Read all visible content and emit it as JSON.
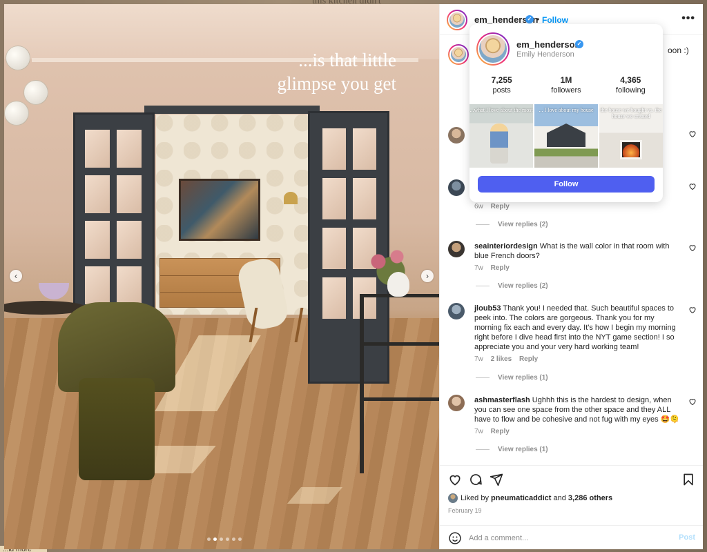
{
  "backdrop": {
    "top_text": "this kitchen didn't",
    "bottom_tag": "...ld more"
  },
  "photo": {
    "overlay_text_line1": "...is that little",
    "overlay_text_line2": "glimpse you get",
    "slide_count": 6,
    "active_slide": 2
  },
  "post": {
    "username": "em_henderson",
    "verified": true,
    "separator": "•",
    "follow_label": "Follow",
    "more_label": "•••",
    "caption_tail": "oon :)"
  },
  "hover_card": {
    "username": "em_henderson",
    "full_name": "Emily Henderson",
    "stats": [
      {
        "value": "7,255",
        "label": "posts"
      },
      {
        "value": "1M",
        "label": "followers"
      },
      {
        "value": "4,365",
        "label": "following"
      }
    ],
    "thumbs": [
      {
        "caption": "...what I love about the most"
      },
      {
        "caption": "... I love about my house"
      },
      {
        "caption": "the house we bought vs. the house we created"
      }
    ],
    "follow_label": "Follow"
  },
  "comments": [
    {
      "username": "",
      "text": "",
      "time": "",
      "likes": "",
      "reply": ""
    },
    {
      "username": "",
      "text": "",
      "time": "6w",
      "likes": "",
      "reply": "Reply",
      "view_replies": "View replies (2)"
    },
    {
      "username": "seainteriordesign",
      "text": "What is the wall color in that room with blue French doors?",
      "time": "7w",
      "likes": "",
      "reply": "Reply",
      "view_replies": "View replies (2)"
    },
    {
      "username": "jloub53",
      "text": "Thank you! I needed that. Such beautiful spaces to peek into. The colors are gorgeous. Thank you for my morning fix each and every day. It's how I begin my morning right before I dive head first into the NYT game section! I so appreciate you and your very hard working team!",
      "time": "7w",
      "likes": "2 likes",
      "reply": "Reply",
      "view_replies": "View replies (1)"
    },
    {
      "username": "ashmasterflash",
      "text": "Ughhh this is the hardest to design, when you can see one space from the other space and they ALL have to flow and be cohesive and not fug with my eyes 🤩🫠",
      "time": "7w",
      "likes": "",
      "reply": "Reply",
      "view_replies": "View replies (1)"
    }
  ],
  "actions": {
    "liked_by_prefix": "Liked by ",
    "liked_by_user": "pneumaticaddict",
    "liked_by_and": " and ",
    "liked_by_count": "3,286 others",
    "date": "February 19",
    "comment_placeholder": "Add a comment...",
    "post_label": "Post"
  },
  "colors": {
    "accent": "#0095f6",
    "card_follow": "#4f5ff0",
    "verified": "#3897f0"
  },
  "icons": [
    "heart-icon",
    "comment-icon",
    "share-icon",
    "bookmark-icon",
    "emoji-icon",
    "verified-icon",
    "more-icon",
    "chevron-left-icon",
    "chevron-right-icon"
  ]
}
